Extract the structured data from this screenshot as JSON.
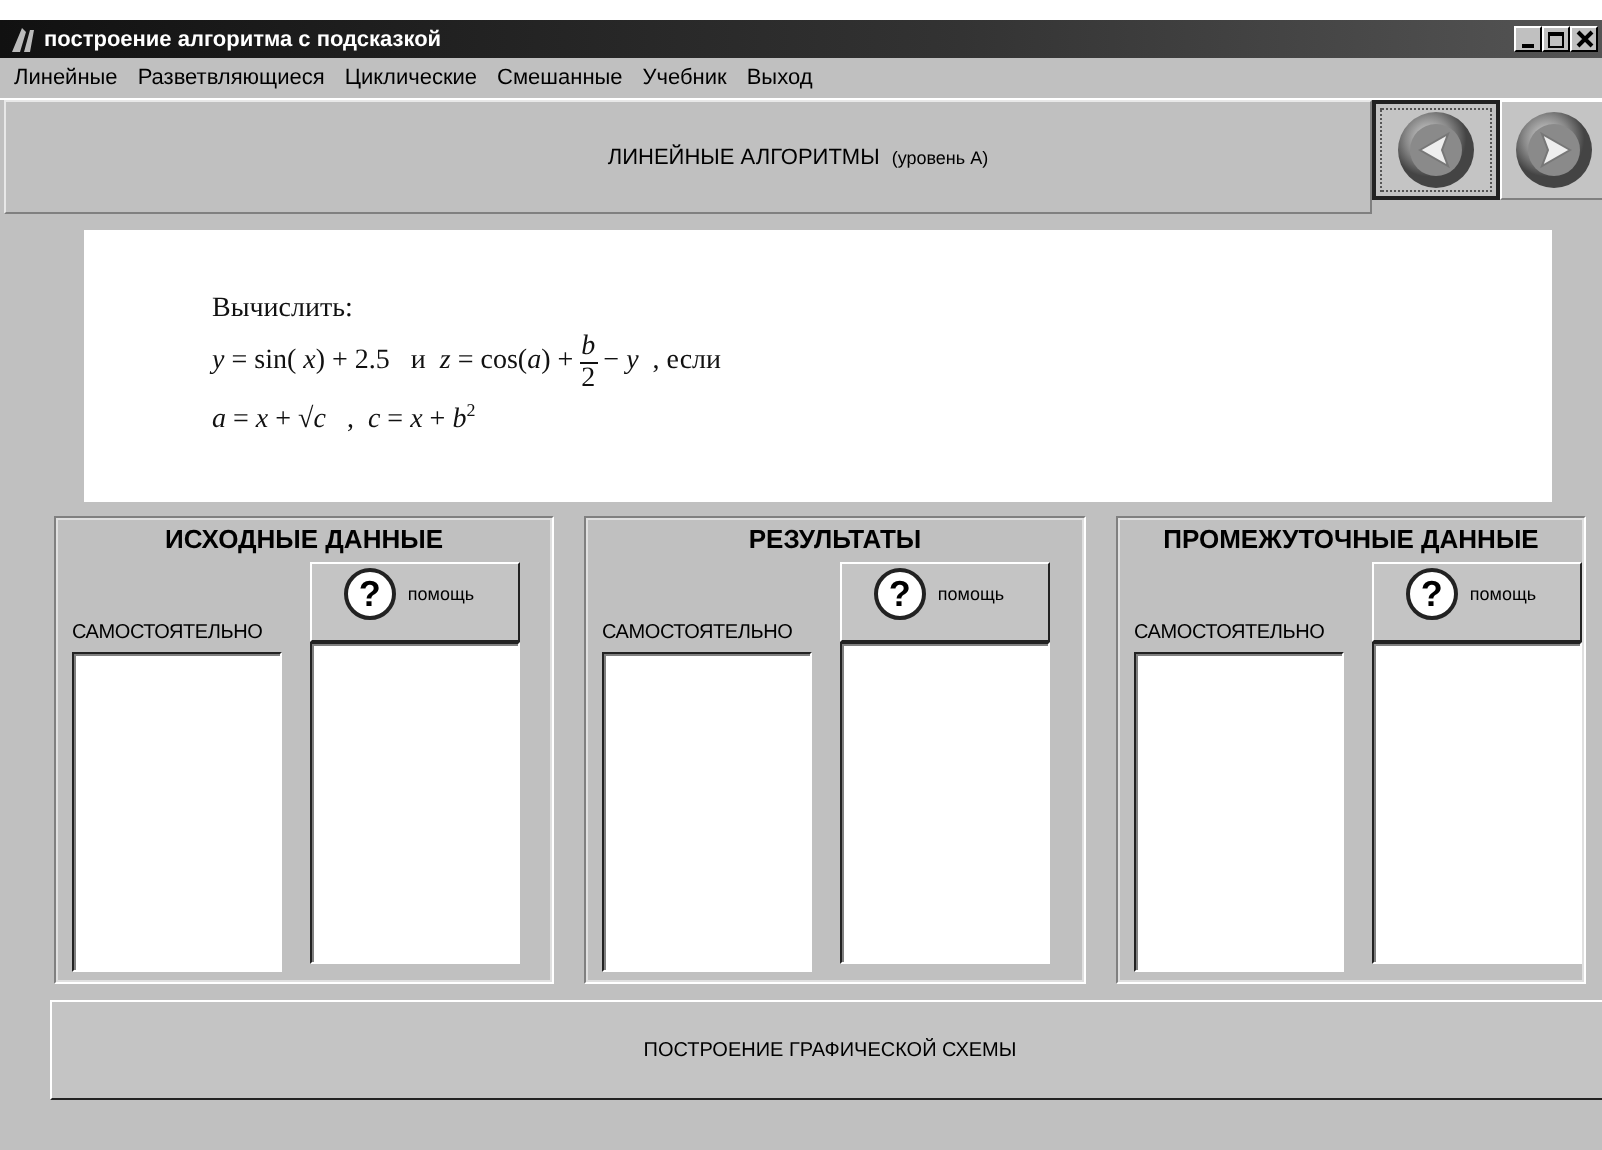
{
  "window": {
    "title": "построение алгоритма с подсказкой"
  },
  "menu": [
    "Линейные",
    "Разветвляющиеся",
    "Циклические",
    "Смешанные",
    "Учебник",
    "Выход"
  ],
  "header": {
    "title": "ЛИНЕЙНЫЕ АЛГОРИТМЫ",
    "subtitle": "(уровень А)",
    "nav_buttons": [
      {
        "kind": "prev",
        "selected": true
      },
      {
        "kind": "next",
        "selected": false
      }
    ]
  },
  "task": {
    "heading": "Вычислить:",
    "lines": [
      [
        {
          "kind": "text",
          "text": "*y* = sin( *x*) + 2.5   и  *z* = cos(*a*) +"
        },
        {
          "kind": "fraction",
          "numerator": "*b*",
          "denominator": "2"
        },
        {
          "kind": "text",
          "text": "− *y*  , если"
        }
      ],
      [
        {
          "kind": "text",
          "text": "*a* = *x* + √*c*   ,  *c* = *x* + *b*$^{2}$"
        }
      ]
    ]
  },
  "groups": [
    {
      "title": "ИСХОДНЫЕ ДАННЫЕ",
      "own_label": "САМОСТОЯТЕЛЬНО",
      "help_icon": "?",
      "help_label": "помощь"
    },
    {
      "title": "РЕЗУЛЬТАТЫ",
      "own_label": "САМОСТОЯТЕЛЬНО",
      "help_icon": "?",
      "help_label": "помощь"
    },
    {
      "title": "ПРОМЕЖУТОЧНЫЕ ДАННЫЕ",
      "own_label": "САМОСТОЯТЕЛЬНО",
      "help_icon": "?",
      "help_label": "помощь"
    }
  ],
  "footer_button": "ПОСТРОЕНИЕ ГРАФИЧЕСКОЙ СХЕМЫ"
}
